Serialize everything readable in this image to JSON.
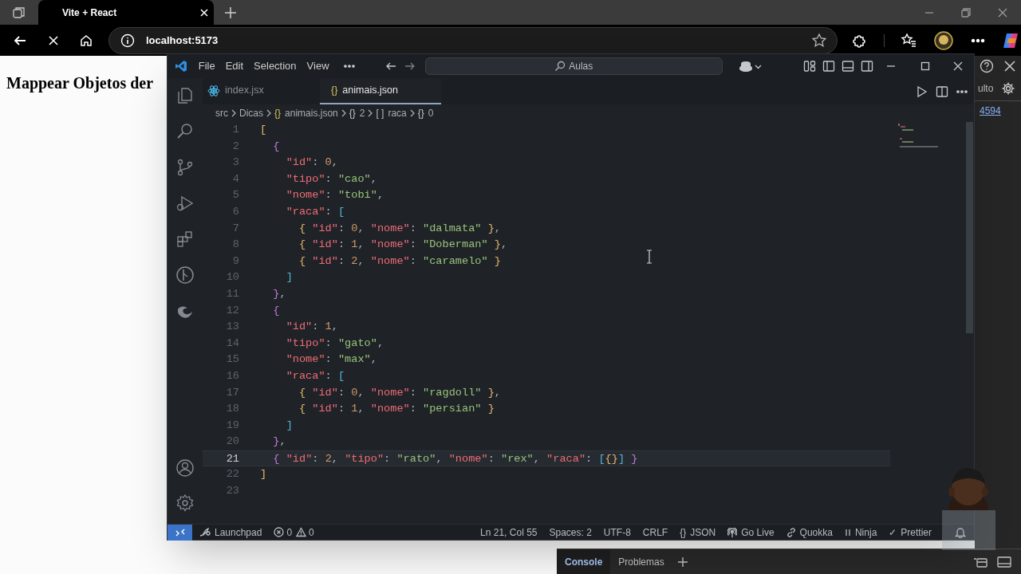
{
  "browser": {
    "tab": {
      "title": "Vite + React"
    },
    "address": "localhost:5173"
  },
  "page": {
    "heading": "Mappear Objetos der"
  },
  "devtools": {
    "partial_label": "ulto",
    "link": "4594",
    "drawer_tabs": [
      {
        "label": "Console",
        "selected": true
      },
      {
        "label": "Problemas",
        "selected": false
      }
    ]
  },
  "vscode": {
    "menu": [
      "File",
      "Edit",
      "Selection",
      "View"
    ],
    "command_center": "Aulas",
    "tabs": [
      {
        "kind": "jsx",
        "label": "index.jsx",
        "selected": false
      },
      {
        "kind": "json",
        "glyph": "{}",
        "label": "animais.json",
        "selected": true
      }
    ],
    "breadcrumbs": [
      {
        "label": "src"
      },
      {
        "label": "Dicas"
      },
      {
        "kind": "file",
        "glyph": "{}",
        "label": "animais.json"
      },
      {
        "kind": "object",
        "glyph": "{}",
        "label": "2"
      },
      {
        "kind": "array",
        "glyph": "[ ]",
        "label": "raca"
      },
      {
        "kind": "object",
        "glyph": "{}",
        "label": "0"
      }
    ],
    "lines": [
      {
        "number": "1",
        "current": false,
        "code": "["
      },
      {
        "number": "2",
        "current": false,
        "code": "  {"
      },
      {
        "number": "3",
        "current": false,
        "code": "    \"id\": 0,"
      },
      {
        "number": "4",
        "current": false,
        "code": "    \"tipo\": \"cao\","
      },
      {
        "number": "5",
        "current": false,
        "code": "    \"nome\": \"tobi\","
      },
      {
        "number": "6",
        "current": false,
        "code": "    \"raca\": ["
      },
      {
        "number": "7",
        "current": false,
        "code": "      { \"id\": 0, \"nome\": \"dalmata\" },"
      },
      {
        "number": "8",
        "current": false,
        "code": "      { \"id\": 1, \"nome\": \"Doberman\" },"
      },
      {
        "number": "9",
        "current": false,
        "code": "      { \"id\": 2, \"nome\": \"caramelo\" }"
      },
      {
        "number": "10",
        "current": false,
        "code": "    ]"
      },
      {
        "number": "11",
        "current": false,
        "code": "  },"
      },
      {
        "number": "12",
        "current": false,
        "code": "  {"
      },
      {
        "number": "13",
        "current": false,
        "code": "    \"id\": 1,"
      },
      {
        "number": "14",
        "current": false,
        "code": "    \"tipo\": \"gato\","
      },
      {
        "number": "15",
        "current": false,
        "code": "    \"nome\": \"max\","
      },
      {
        "number": "16",
        "current": false,
        "code": "    \"raca\": ["
      },
      {
        "number": "17",
        "current": false,
        "code": "      { \"id\": 0, \"nome\": \"ragdoll\" },"
      },
      {
        "number": "18",
        "current": false,
        "code": "      { \"id\": 1, \"nome\": \"persian\" }"
      },
      {
        "number": "19",
        "current": false,
        "code": "    ]"
      },
      {
        "number": "20",
        "current": false,
        "code": "  },"
      },
      {
        "number": "21",
        "current": true,
        "code": "  { \"id\": 2, \"tipo\": \"rato\", \"nome\": \"rex\", \"raca\": [{}] }"
      },
      {
        "number": "22",
        "current": false,
        "code": "]"
      },
      {
        "number": "23",
        "current": false
      }
    ],
    "status_left": [
      {
        "kind": "remote"
      },
      {
        "kind": "launchpad",
        "label": "Launchpad"
      },
      {
        "kind": "problems",
        "errors": "0",
        "warnings": "0"
      }
    ],
    "status_right": [
      {
        "kind": "text",
        "label": "Ln 21, Col 55"
      },
      {
        "kind": "text",
        "label": "Spaces: 2"
      },
      {
        "kind": "text",
        "label": "UTF-8"
      },
      {
        "kind": "text",
        "label": "CRLF"
      },
      {
        "kind": "text",
        "glyph": "{}",
        "label": "JSON"
      },
      {
        "kind": "golive",
        "label": "Go Live"
      },
      {
        "kind": "quokka",
        "label": "Quokka"
      },
      {
        "kind": "ninja",
        "label": "Ninja"
      },
      {
        "kind": "text",
        "glyph": "✓",
        "label": "Prettier"
      },
      {
        "kind": "notifications"
      }
    ]
  }
}
